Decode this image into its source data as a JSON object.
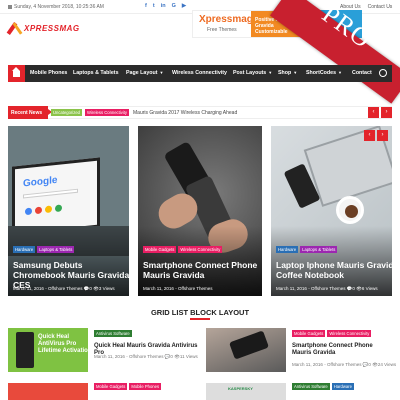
{
  "topbar": {
    "date": "Sunday, 4 November 2018, 10:25:36 AM",
    "socials": [
      "f",
      "t",
      "in",
      "G",
      "▶"
    ],
    "links": [
      "About Us",
      "Contact Us"
    ]
  },
  "header": {
    "logo": "XPRESSMAG",
    "banner_title": "Xpressmag",
    "banner_sub": "Free Themes",
    "banner_promo": "Positive Ma Gravida Customizable"
  },
  "pro_ribbon": "PRO",
  "nav": {
    "items": [
      "Mobile Phones",
      "Laptops & Tablets",
      "Page Layout",
      "Wireless Connectivity",
      "Post Layouts",
      "Shop",
      "ShortCodes",
      "Contact"
    ],
    "has_dropdown": [
      false,
      false,
      true,
      false,
      true,
      true,
      true,
      false
    ]
  },
  "recent_news": {
    "label": "Recent News",
    "tags": [
      "Uncategorized",
      "Wireless Connectivity"
    ],
    "title": "Mauris Gravida 2017 Wireless Charging Ahead",
    "prev": "‹",
    "next": "›"
  },
  "featured": [
    {
      "tags": [
        "Hardware",
        "Laptops & Tablets"
      ],
      "title": "Samsung Debuts Chromebook Mauris Gravida CES",
      "date": "March 11, 2016",
      "author": "Offshore Themes",
      "comments": "0",
      "views": "3 Views",
      "google_text": "Google"
    },
    {
      "tags": [
        "Mobile Gadgets",
        "Wireless Connectivity"
      ],
      "title": "Smartphone Connect Phone Mauris Gravida",
      "date": "March 11, 2016",
      "author": "Offshore Themes",
      "comments": "",
      "views": ""
    },
    {
      "tags": [
        "Hardware",
        "Laptops & Tablets"
      ],
      "title": "Laptop Iphone Mauris Gravida Coffee Notebook",
      "date": "March 11, 2016",
      "author": "Offshore Themes",
      "comments": "0",
      "views": "6 Views",
      "prev": "‹",
      "next": "›"
    }
  ],
  "grid_block": {
    "title": "GRID LIST BLOCK LAYOUT",
    "items": [
      {
        "tags": [
          "Antivirus Software"
        ],
        "title": "Quick Heal Mauris Gravida Antivirus Pro",
        "date": "March 11, 2016",
        "author": "Offshore Themes",
        "comments": "0",
        "views": "11 Views",
        "thumb_text": "Quick Heal AntiVirus Pro Lifetime Activatio"
      },
      {
        "tags": [
          "Mobile Gadgets",
          "Wireless Connectivity"
        ],
        "title": "Smartphone Connect Phone Mauris Gravida",
        "date": "March 11, 2016",
        "author": "Offshore Themes",
        "comments": "0",
        "views": "24 Views"
      },
      {
        "tags": [
          "Mobile Gadgets",
          "Mobile Phones"
        ],
        "title": "",
        "date": "",
        "author": "",
        "comments": "",
        "views": ""
      },
      {
        "tags": [
          "Antivirus Software",
          "Hardware"
        ],
        "title": "",
        "date": "",
        "author": "",
        "comments": "",
        "views": "",
        "thumb_text": "KASPERSKY"
      }
    ]
  },
  "colors": {
    "accent": "#e3242b",
    "nav_bg": "#2b2b2b",
    "tag_green": "#8bc34a",
    "tag_pink": "#e91e63",
    "tag_blue": "#2a6fb5",
    "tag_purple": "#9c27b0",
    "tag_red": "#e3242b",
    "tag_darkgreen": "#2e7d32"
  }
}
